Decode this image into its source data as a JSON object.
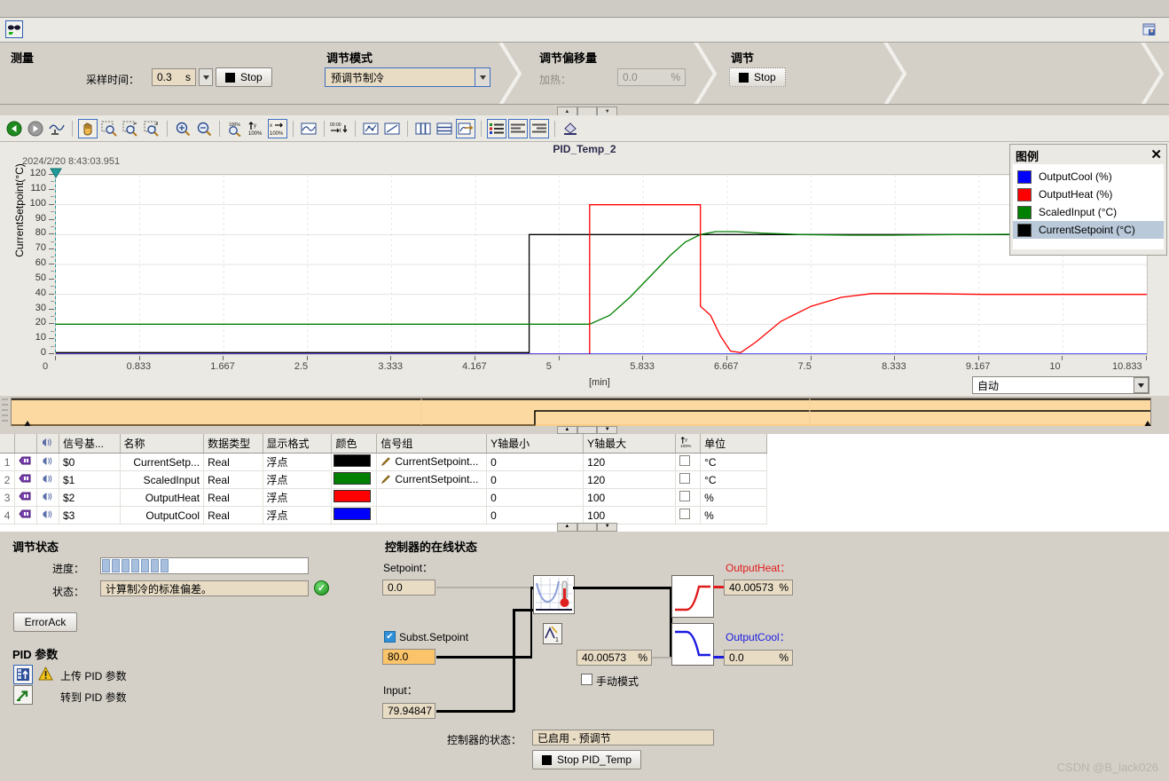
{
  "window": {
    "left_icon": "glasses-icon",
    "right_icon": "window-restore-icon"
  },
  "ribbon": {
    "sections": [
      {
        "title": "测量"
      },
      {
        "title": "调节模式"
      },
      {
        "title": "调节偏移量"
      },
      {
        "title": "调节"
      }
    ],
    "sample_time_label": "采样时间：",
    "sample_time_value": "0.3",
    "sample_time_unit": "s",
    "measure_stop_label": "Stop",
    "tuning_mode_value": "预调节制冷",
    "offset_heat_label": "加热：",
    "offset_heat_value": "0.0",
    "offset_heat_unit": "%",
    "tuning_stop_label": "Stop"
  },
  "toolbar": {
    "icons": [
      "back-arrow-icon",
      "forward-arrow-icon",
      "curve-marker-icon",
      "pan-hand-icon",
      "zoom-region-icon",
      "zoom-horizontal-icon",
      "zoom-vertical-icon",
      "zoom-in-icon",
      "zoom-out-icon",
      "zoom-100-icon",
      "scale-y-100-icon",
      "scale-x-100-icon",
      "smooth-curve-icon",
      "time-axis-icon",
      "show-points-icon",
      "show-lines-icon",
      "vertical-split-icon",
      "horizontal-split-icon",
      "insert-curve-icon",
      "legend-icon",
      "align-left-icon",
      "align-right-icon",
      "color-fill-icon"
    ],
    "selected": [
      "pan-hand-icon",
      "scale-x-100-icon",
      "insert-curve-icon",
      "legend-icon",
      "align-left-icon",
      "align-right-icon"
    ]
  },
  "chart_data": {
    "type": "line",
    "title": "PID_Temp_2",
    "timestamp": "2024/2/20 8:43:03.951",
    "xlabel": "[min]",
    "ylabel": "CurrentSetpoint(°C)",
    "xlim": [
      0,
      10.833
    ],
    "ylim": [
      0,
      120
    ],
    "grid": true,
    "legend_position": "top-right",
    "xticks": [
      "0",
      "0.833",
      "1.667",
      "2.5",
      "3.333",
      "4.167",
      "5",
      "5.833",
      "6.667",
      "7.5",
      "8.333",
      "9.167",
      "10",
      "10.833"
    ],
    "yticks": [
      "0",
      "10",
      "20",
      "30",
      "40",
      "50",
      "60",
      "70",
      "80",
      "90",
      "100",
      "110",
      "120"
    ],
    "series": [
      {
        "name": "CurrentSetpoint (°C)",
        "color": "#000000",
        "unit": "°C",
        "points": [
          [
            0,
            1
          ],
          [
            4.7,
            1
          ],
          [
            4.7,
            80
          ],
          [
            10.833,
            80
          ]
        ]
      },
      {
        "name": "ScaledInput (°C)",
        "color": "#008000",
        "unit": "°C",
        "points": [
          [
            0,
            20
          ],
          [
            5.3,
            20
          ],
          [
            5.5,
            26
          ],
          [
            5.7,
            38
          ],
          [
            5.9,
            52
          ],
          [
            6.1,
            66
          ],
          [
            6.25,
            75
          ],
          [
            6.4,
            80
          ],
          [
            6.55,
            82
          ],
          [
            6.75,
            82
          ],
          [
            7.0,
            81
          ],
          [
            7.4,
            80
          ],
          [
            7.9,
            79.6
          ],
          [
            8.3,
            79.6
          ],
          [
            8.8,
            79.9
          ],
          [
            9.4,
            80.2
          ],
          [
            10.0,
            80.4
          ],
          [
            10.833,
            80.6
          ]
        ]
      },
      {
        "name": "OutputHeat (%)",
        "color": "#ff0000",
        "unit": "%",
        "points": [
          [
            0,
            0
          ],
          [
            5.3,
            0
          ],
          [
            5.3,
            100
          ],
          [
            6.4,
            100
          ],
          [
            6.4,
            32
          ],
          [
            6.5,
            26
          ],
          [
            6.6,
            12
          ],
          [
            6.7,
            2
          ],
          [
            6.8,
            1
          ],
          [
            6.95,
            8
          ],
          [
            7.2,
            22
          ],
          [
            7.5,
            32
          ],
          [
            7.8,
            38
          ],
          [
            8.1,
            40.5
          ],
          [
            8.6,
            40.5
          ],
          [
            9.2,
            40
          ],
          [
            10.833,
            40
          ]
        ]
      },
      {
        "name": "OutputCool (%)",
        "color": "#0000ff",
        "unit": "%",
        "points": [
          [
            0,
            0
          ],
          [
            10.833,
            0
          ]
        ]
      }
    ]
  },
  "legend": {
    "title": "图例",
    "close_icon": "close-icon",
    "items": [
      {
        "label": "OutputCool (%)",
        "color": "#0000ff",
        "selected": false
      },
      {
        "label": "OutputHeat (%)",
        "color": "#ff0000",
        "selected": false
      },
      {
        "label": "ScaledInput (°C)",
        "color": "#008000",
        "selected": false
      },
      {
        "label": "CurrentSetpoint (°C)",
        "color": "#000000",
        "selected": true
      }
    ]
  },
  "axis_mode": {
    "value": "自动",
    "icon": "chevron-down-icon"
  },
  "signal_table": {
    "columns": [
      "",
      "",
      "",
      "信号基...",
      "名称",
      "数据类型",
      "显示格式",
      "颜色",
      "信号组",
      "Y轴最小",
      "Y轴最大",
      "",
      "单位"
    ],
    "y_scale_icon": "scale-y-100-icon",
    "rows": [
      {
        "num": "1",
        "tag_icon": "tag-icon",
        "vis_icon": "visibility-icon",
        "base": "$0",
        "name": "CurrentSetp...",
        "dtype": "Real",
        "format": "浮点",
        "color": "#000000",
        "pen_icon": "pen-icon",
        "group": "CurrentSetpoint...",
        "ymin": "0",
        "ymax": "120",
        "checked": false,
        "unit": "°C"
      },
      {
        "num": "2",
        "tag_icon": "tag-icon",
        "vis_icon": "visibility-icon",
        "base": "$1",
        "name": "ScaledInput",
        "dtype": "Real",
        "format": "浮点",
        "color": "#008000",
        "pen_icon": "pen-icon",
        "group": "CurrentSetpoint...",
        "ymin": "0",
        "ymax": "120",
        "checked": false,
        "unit": "°C"
      },
      {
        "num": "3",
        "tag_icon": "tag-icon",
        "vis_icon": "visibility-icon",
        "base": "$2",
        "name": "OutputHeat",
        "dtype": "Real",
        "format": "浮点",
        "color": "#ff0000",
        "pen_icon": "",
        "group": "",
        "ymin": "0",
        "ymax": "100",
        "checked": false,
        "unit": "%"
      },
      {
        "num": "4",
        "tag_icon": "tag-icon",
        "vis_icon": "visibility-icon",
        "base": "$3",
        "name": "OutputCool",
        "dtype": "Real",
        "format": "浮点",
        "color": "#0000ff",
        "pen_icon": "",
        "group": "",
        "ymin": "0",
        "ymax": "100",
        "checked": false,
        "unit": "%"
      }
    ]
  },
  "tuning_status": {
    "heading": "调节状态",
    "progress_label": "进度：",
    "progress_chunks": 7,
    "status_label": "状态：",
    "status_value": "计算制冷的标准偏差。",
    "status_badge": "ok-check-icon",
    "error_ack_button": "ErrorAck"
  },
  "pid_params": {
    "heading": "PID 参数",
    "upload_label": "上传 PID 参数",
    "upload_icon": "upload-pid-icon",
    "warn_icon": "warning-icon",
    "goto_label": "转到 PID 参数",
    "goto_icon": "goto-arrow-icon"
  },
  "controller_online": {
    "heading": "控制器的在线状态",
    "setpoint_label": "Setpoint：",
    "setpoint_value": "0.0",
    "subst_setpoint_label": "Subst.Setpoint",
    "subst_setpoint_checked": true,
    "subst_setpoint_value": "80.0",
    "input_label": "Input：",
    "input_value": "79.94847",
    "pid_block_icon": "pid-curve-thermometer-icon",
    "error_block_icon": "deviation-icon",
    "mid_output_value": "40.00573",
    "mid_output_unit": "%",
    "manual_mode_label": "手动模式",
    "manual_mode_checked": false,
    "heat_block_icon": "heat-ramp-icon",
    "cool_block_icon": "cool-ramp-icon",
    "output_heat_label": "OutputHeat：",
    "output_heat_color": "#e01b1b",
    "output_heat_value": "40.00573",
    "output_heat_unit": "%",
    "output_cool_label": "OutputCool：",
    "output_cool_color": "#1b1be0",
    "output_cool_value": "0.0",
    "output_cool_unit": "%",
    "controller_state_label": "控制器的状态：",
    "controller_state_value": "已启用 - 预调节",
    "stop_button": "Stop PID_Temp"
  },
  "watermark": "CSDN @B_lack026"
}
